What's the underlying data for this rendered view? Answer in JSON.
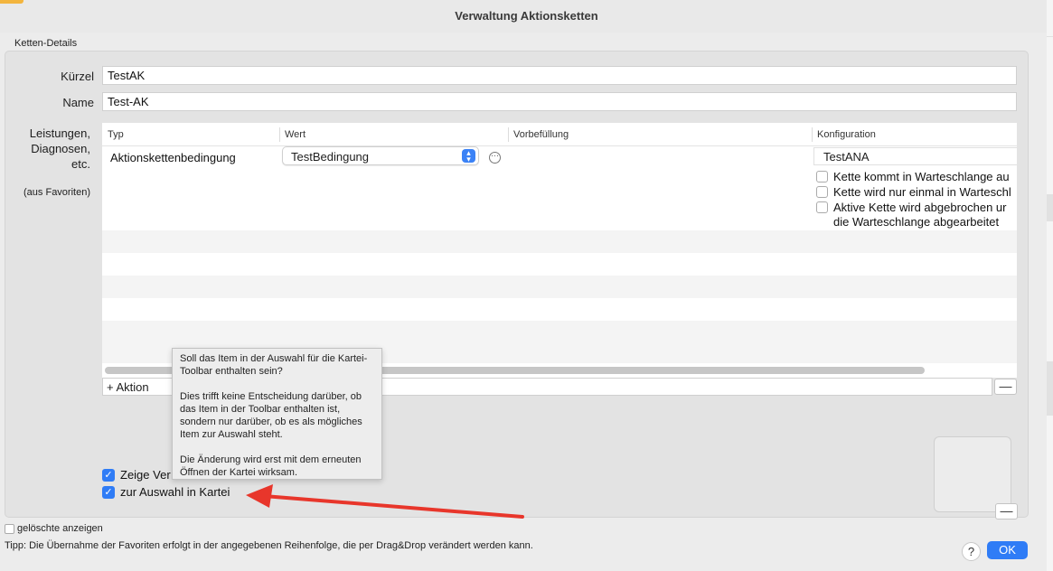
{
  "window": {
    "title": "Verwaltung Aktionsketten"
  },
  "section": {
    "label": "Ketten-Details"
  },
  "form": {
    "kuerzel_label": "Kürzel",
    "kuerzel_value": "TestAK",
    "name_label": "Name",
    "name_value": "Test-AK",
    "items_label_1": "Leistungen,",
    "items_label_2": "Diagnosen,",
    "items_label_3": "etc.",
    "favorites_label": "(aus Favoriten)"
  },
  "table": {
    "columns": [
      "Typ",
      "Wert",
      "Vorbefüllung",
      "Konfiguration"
    ],
    "row": {
      "typ": "Aktionskettenbedingung",
      "wert": "TestBedingung",
      "konfiguration": "TestANA",
      "options": [
        {
          "label": "Kette kommt in Warteschlange au",
          "checked": false
        },
        {
          "label": "Kette wird nur einmal in Warteschl",
          "checked": false
        },
        {
          "label": "Aktive Kette wird abgebrochen ur",
          "checked": false
        }
      ],
      "option_continuation": "die Warteschlange abgearbeitet"
    }
  },
  "action_bar": {
    "add_label": "+ Aktion",
    "remove_label": "—"
  },
  "checks": {
    "zeige_label": "Zeige Ver",
    "zeige_checked": true,
    "auswahl_label": "zur Auswahl in Kartei",
    "auswahl_checked": true
  },
  "tooltip": {
    "para1": "Soll das Item in der Auswahl für die Kartei-Toolbar enthalten sein?",
    "para2": "Dies trifft keine Entscheidung darüber, ob das Item in der Toolbar enthalten ist, sondern nur darüber, ob es als mögliches Item zur Auswahl steht.",
    "para3": "Die Änderung wird erst mit dem erneuten Öffnen der Kartei wirksam."
  },
  "footer": {
    "show_deleted_label": "gelöschte anzeigen",
    "tip": "Tipp: Die Übernahme der Favoriten erfolgt in der angegebenen Reihenfolge, die per Drag&Drop verändert werden kann.",
    "help_label": "?",
    "ok_label": "OK"
  },
  "colors": {
    "accent": "#2f7cf6",
    "arrow": "#e8362b",
    "stepper": "#3b82f6"
  }
}
